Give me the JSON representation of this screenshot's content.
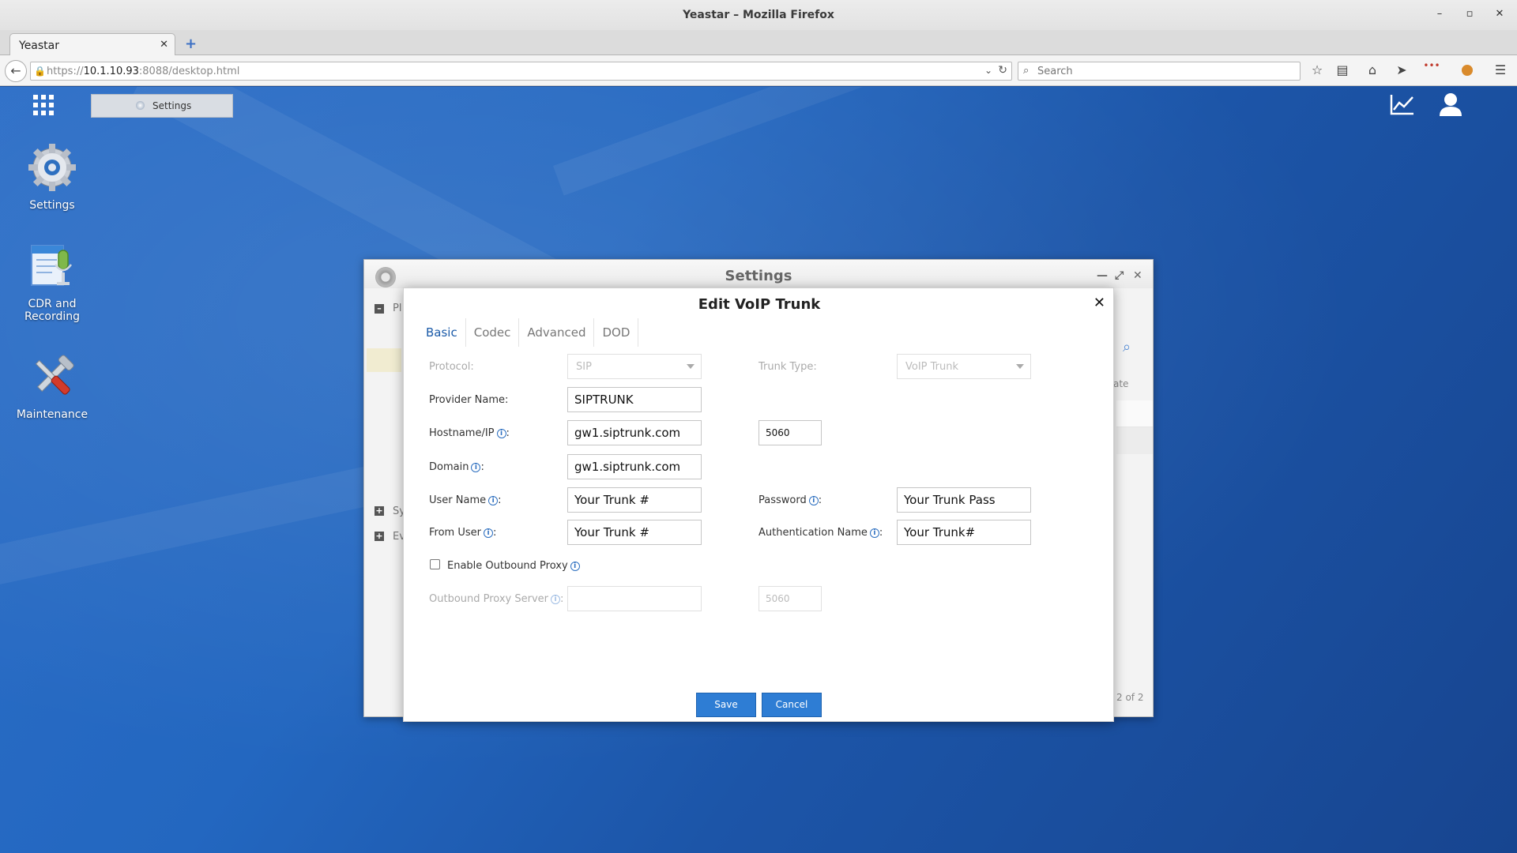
{
  "browser": {
    "window_title": "Yeastar – Mozilla Firefox",
    "tab_title": "Yeastar",
    "url_prefix": "https://",
    "url_host": "10.1.10.93",
    "url_rest": ":8088/desktop.html",
    "search_placeholder": "Search"
  },
  "taskbar": {
    "settings_label": "Settings"
  },
  "desktop_icons": [
    {
      "label": "Settings",
      "icon": "settings-gear-icon"
    },
    {
      "label": "CDR and\nRecording",
      "icon": "cdr-recording-icon"
    },
    {
      "label": "Maintenance",
      "icon": "maintenance-tools-icon"
    }
  ],
  "settings_window": {
    "title": "Settings",
    "side_items": [
      "Pl",
      "Sy",
      "Ev"
    ],
    "column_fragment": "ate",
    "pager_text": "2 of 2"
  },
  "dialog": {
    "title": "Edit VoIP Trunk",
    "tabs": [
      "Basic",
      "Codec",
      "Advanced",
      "DOD"
    ],
    "active_tab": "Basic",
    "fields": {
      "protocol_label": "Protocol:",
      "protocol_value": "SIP",
      "trunk_type_label": "Trunk Type:",
      "trunk_type_value": "VoIP Trunk",
      "provider_name_label": "Provider Name:",
      "provider_name_value": "SIPTRUNK",
      "hostname_label": "Hostname/IP",
      "hostname_value": "gw1.siptrunk.com",
      "hostname_port": "5060",
      "domain_label": "Domain",
      "domain_value": "gw1.siptrunk.com",
      "user_name_label": "User Name",
      "user_name_value": "Your Trunk #",
      "password_label": "Password",
      "password_value": "Your Trunk Pass",
      "from_user_label": "From User",
      "from_user_value": "Your Trunk #",
      "auth_name_label": "Authentication Name",
      "auth_name_value": "Your Trunk#",
      "outbound_proxy_label": "Enable Outbound Proxy",
      "outbound_proxy_checked": false,
      "proxy_server_label": "Outbound Proxy Server",
      "proxy_server_value": "",
      "proxy_port": "5060"
    },
    "save_label": "Save",
    "cancel_label": "Cancel"
  },
  "colors": {
    "accent": "#2e7dd4",
    "desktop": "#2367c0",
    "tab_active": "#1a5aa8"
  }
}
